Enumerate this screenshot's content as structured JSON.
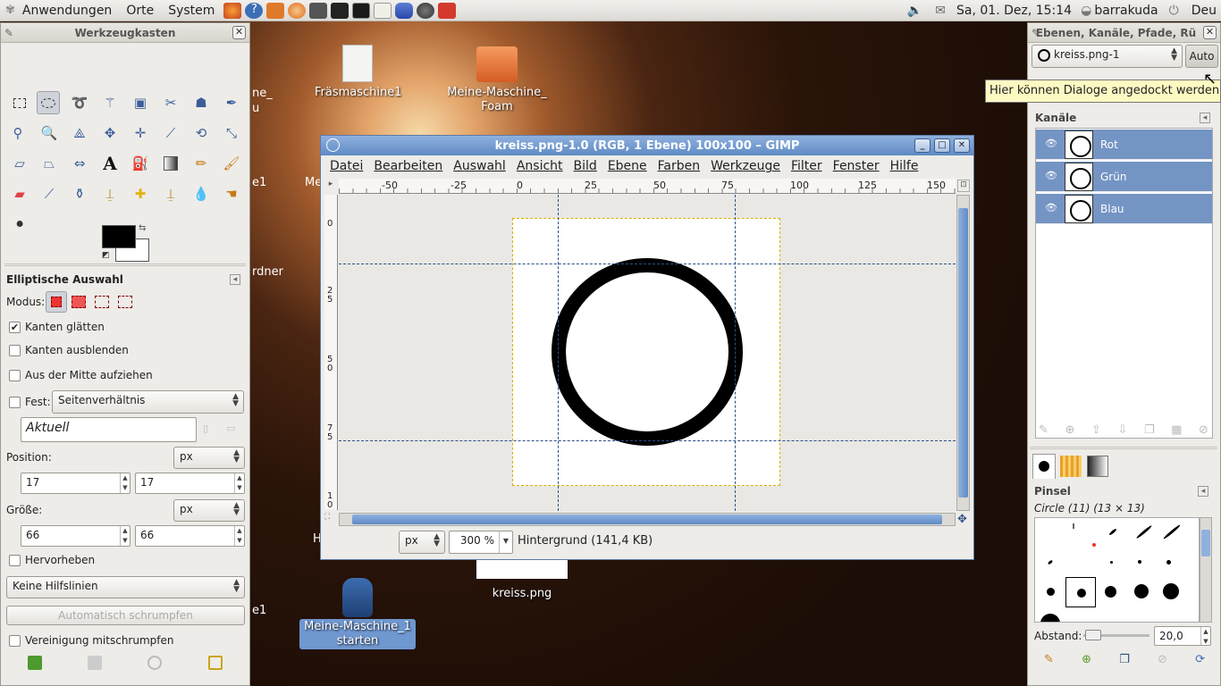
{
  "top_panel": {
    "menus": [
      "Anwendungen",
      "Orte",
      "System"
    ],
    "datetime": "Sa, 01. Dez, 15:14",
    "user": "barrakuda",
    "lang": "Deu"
  },
  "toolbox": {
    "title": "Werkzeugkasten",
    "tool_options_title": "Elliptische Auswahl",
    "modus_label": "Modus:",
    "antialias": "Kanten glätten",
    "feather": "Kanten ausblenden",
    "from_center": "Aus der Mitte aufziehen",
    "fixed_label": "Fest:",
    "fixed_value": "Seitenverhältnis",
    "fixed_entry": "Aktuell",
    "position_label": "Position:",
    "position_unit": "px",
    "position_x": "17",
    "position_y": "17",
    "size_label": "Größe:",
    "size_unit": "px",
    "size_w": "66",
    "size_h": "66",
    "highlight": "Hervorheben",
    "guides": "Keine Hilfslinien",
    "auto_shrink": "Automatisch schrumpfen",
    "shrink_merged": "Vereinigung mitschrumpfen"
  },
  "desktop": {
    "icons": [
      "Fräsmaschine1",
      "Meine-Maschine_ Foam",
      "kreiss.png",
      "Meine-Maschine_1 starten"
    ],
    "cut_labels": [
      "ne_",
      "u",
      "e1",
      "Me",
      "rdner",
      "H",
      "e1"
    ]
  },
  "gimp": {
    "title": "kreiss.png-1.0 (RGB, 1 Ebene) 100x100 – GIMP",
    "menu": [
      "Datei",
      "Bearbeiten",
      "Auswahl",
      "Ansicht",
      "Bild",
      "Ebene",
      "Farben",
      "Werkzeuge",
      "Filter",
      "Fenster",
      "Hilfe"
    ],
    "hruler": [
      "-50",
      "-25",
      "0",
      "25",
      "50",
      "75",
      "100",
      "125",
      "150"
    ],
    "vruler": [
      "0",
      "2 5",
      "5 0",
      "7 5",
      "1 0"
    ],
    "unit": "px",
    "zoom": "300 %",
    "status": "Hintergrund (141,4 KB)"
  },
  "dock": {
    "title": "Ebenen, Kanäle, Pfade, Rü",
    "image_select": "kreiss.png-1",
    "auto_button": "Auto",
    "tooltip": "Hier können Dialoge angedockt werden",
    "channels_title": "Kanäle",
    "channels": [
      "Rot",
      "Grün",
      "Blau"
    ],
    "brushes_title": "Pinsel",
    "brush_name": "Circle (11) (13 × 13)",
    "spacing_label": "Abstand:",
    "spacing_value": "20,0"
  }
}
